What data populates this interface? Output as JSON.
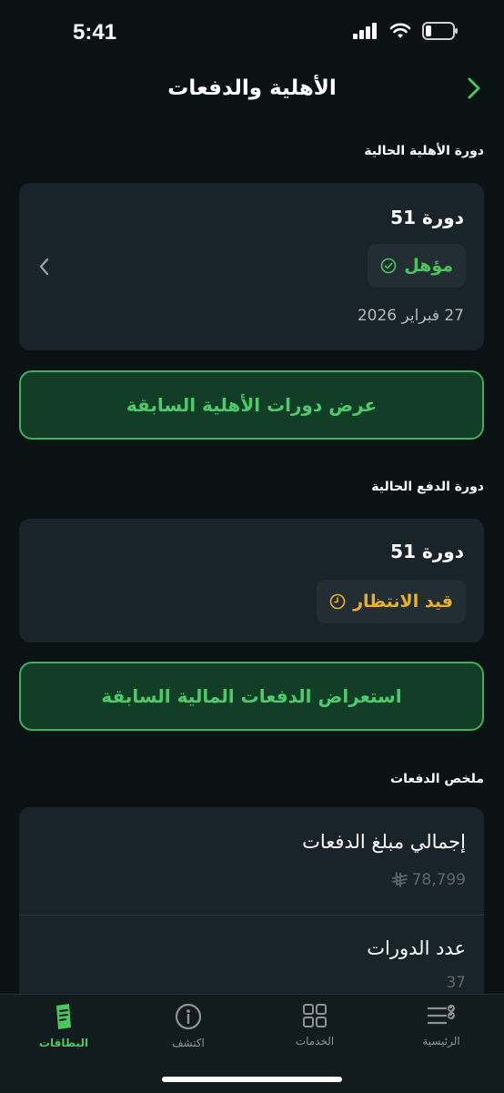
{
  "status_bar": {
    "time": "5:41"
  },
  "header": {
    "title": "الأهلية والدفعات"
  },
  "eligibility": {
    "section_label": "دورة الأهلية الحالية",
    "cycle_title": "دورة 51",
    "status": "مؤهل",
    "date": "27 فبراير 2026",
    "button_label": "عرض دورات الأهلية السابقة"
  },
  "payment": {
    "section_label": "دورة الدفع الحالية",
    "cycle_title": "دورة 51",
    "status": "قيد الانتظار",
    "button_label": "استعراض الدفعات المالية السابقة"
  },
  "summary": {
    "section_label": "ملخص الدفعات",
    "total_label": "إجمالي مبلغ الدفعات",
    "total_value": "78,799",
    "cycles_label": "عدد الدورات",
    "cycles_value": "37"
  },
  "tabs": [
    {
      "label": "البطاقات",
      "icon": "cards-icon",
      "active": true
    },
    {
      "label": "اكتشف",
      "icon": "info-icon",
      "active": false
    },
    {
      "label": "الخدمات",
      "icon": "grid-icon",
      "active": false
    },
    {
      "label": "الرئيسية",
      "icon": "checklist-icon",
      "active": false
    }
  ],
  "colors": {
    "background": "#0b1214",
    "card": "#19232a",
    "accent_green": "#4ec45f",
    "pending_yellow": "#e9b12c"
  }
}
